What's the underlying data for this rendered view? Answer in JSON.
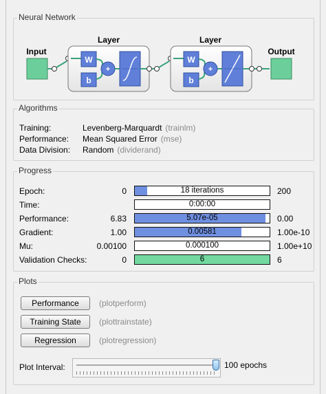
{
  "network": {
    "title": "Neural Network",
    "input_label": "Input",
    "output_label": "Output",
    "layer1_label": "Layer",
    "layer2_label": "Layer",
    "w_label": "W",
    "b_label": "b",
    "plus_symbol": "+"
  },
  "algorithms": {
    "title": "Algorithms",
    "rows": [
      {
        "label": "Training:",
        "value": "Levenberg-Marquardt",
        "code": "(trainlm)"
      },
      {
        "label": "Performance:",
        "value": "Mean Squared Error",
        "code": "(mse)"
      },
      {
        "label": "Data Division:",
        "value": "Random",
        "code": "(dividerand)"
      }
    ]
  },
  "progress": {
    "title": "Progress",
    "rows": [
      {
        "label": "Epoch:",
        "start": "0",
        "bar_text": "18 iterations",
        "end": "200",
        "fill": 0.09,
        "fill_color": "#6f8fe0"
      },
      {
        "label": "Time:",
        "start": "",
        "bar_text": "0:00:00",
        "end": "",
        "fill": 0,
        "fill_color": "#6f8fe0"
      },
      {
        "label": "Performance:",
        "start": "6.83",
        "bar_text": "5.07e-05",
        "end": "0.00",
        "fill": 0.97,
        "fill_color": "#6f8fe0"
      },
      {
        "label": "Gradient:",
        "start": "1.00",
        "bar_text": "0.00581",
        "end": "1.00e-10",
        "fill": 0.79,
        "fill_color": "#6f8fe0"
      },
      {
        "label": "Mu:",
        "start": "0.00100",
        "bar_text": "0.000100",
        "end": "1.00e+10",
        "fill": 0,
        "fill_color": "#6f8fe0"
      },
      {
        "label": "Validation Checks:",
        "start": "0",
        "bar_text": "6",
        "end": "6",
        "fill": 1.0,
        "fill_color": "#72d8a0"
      }
    ]
  },
  "plots": {
    "title": "Plots",
    "buttons": [
      {
        "label": "Performance",
        "code": "(plotperform)"
      },
      {
        "label": "Training State",
        "code": "(plottrainstate)"
      },
      {
        "label": "Regression",
        "code": "(plotregression)"
      }
    ],
    "interval_label": "Plot Interval:",
    "interval_value": "100 epochs",
    "slider_fraction": 1.0
  },
  "colors": {
    "io_box": "#6ccf9b",
    "layer_box": "#5f7fd8",
    "connector": "#3aa47a"
  }
}
